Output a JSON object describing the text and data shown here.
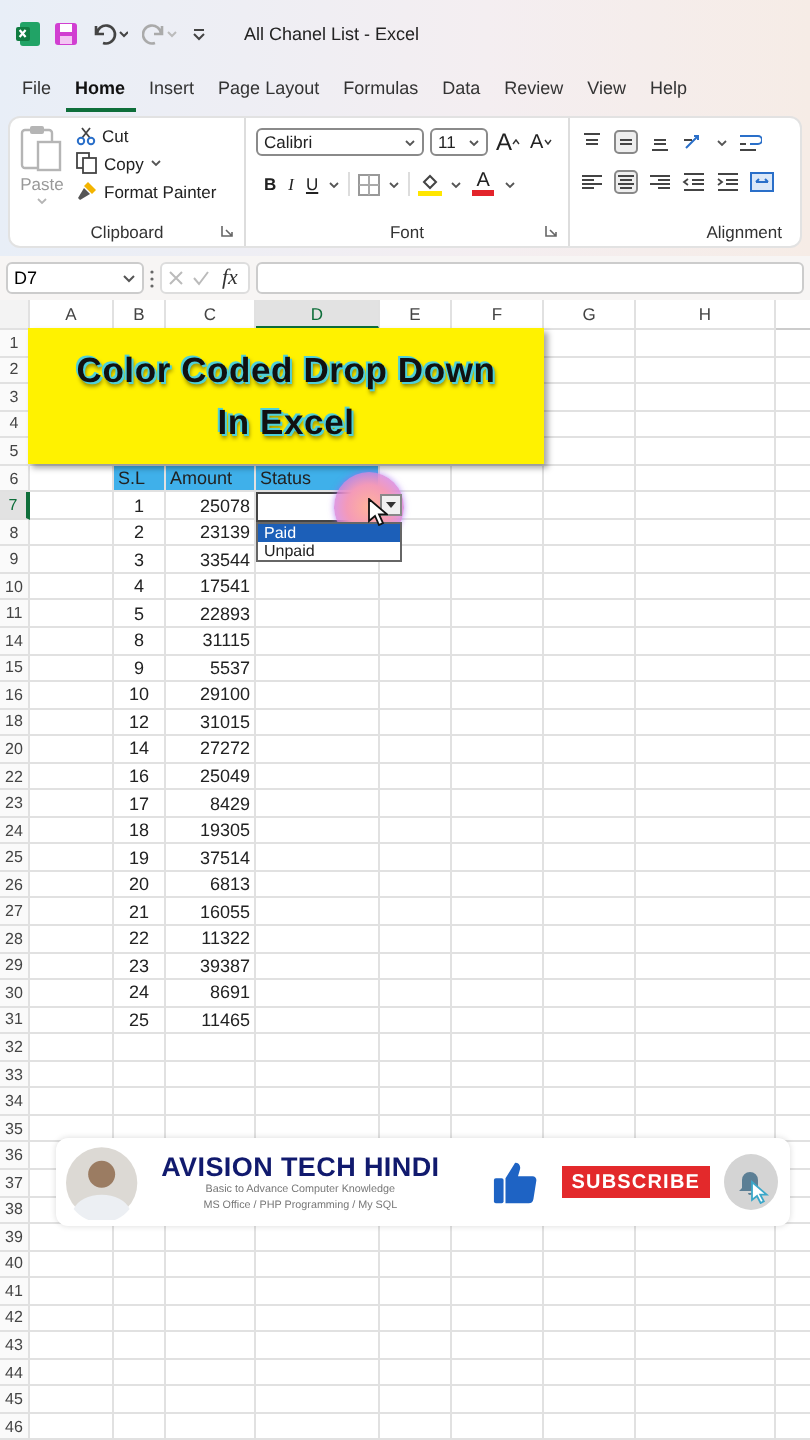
{
  "title_bar": {
    "title": "All Chanel List - Excel"
  },
  "ribbon_tabs": [
    {
      "label": "File",
      "selected": false
    },
    {
      "label": "Home",
      "selected": true
    },
    {
      "label": "Insert",
      "selected": false
    },
    {
      "label": "Page Layout",
      "selected": false
    },
    {
      "label": "Formulas",
      "selected": false
    },
    {
      "label": "Data",
      "selected": false
    },
    {
      "label": "Review",
      "selected": false
    },
    {
      "label": "View",
      "selected": false
    },
    {
      "label": "Help",
      "selected": false
    }
  ],
  "clipboard": {
    "paste": {
      "label": "Paste",
      "disabled": true
    },
    "commands": [
      "Cut",
      "Copy",
      "Format Painter"
    ],
    "group_label": "Clipboard"
  },
  "font": {
    "font_name": "Calibri",
    "font_size": "11",
    "grow_label": "A",
    "shrink_label": "A",
    "bold_label": "B",
    "italic_label": "I",
    "underline_label": "U",
    "font_color_label": "A",
    "group_label": "Font"
  },
  "alignment": {
    "group_label": "Alignment"
  },
  "formula_bar": {
    "name_box": "D7",
    "function_label": "fx"
  },
  "columns": [
    {
      "label": "A",
      "selected": false
    },
    {
      "label": "B",
      "selected": false
    },
    {
      "label": "C",
      "selected": false
    },
    {
      "label": "D",
      "selected": true
    },
    {
      "label": "E",
      "selected": false
    },
    {
      "label": "F",
      "selected": false
    },
    {
      "label": "G",
      "selected": false
    },
    {
      "label": "H",
      "selected": false
    }
  ],
  "rows": [
    {
      "number": "1",
      "selected": false,
      "kind": "empty"
    },
    {
      "number": "2",
      "selected": false,
      "kind": "empty"
    },
    {
      "number": "3",
      "selected": false,
      "kind": "empty"
    },
    {
      "number": "4",
      "selected": false,
      "kind": "empty"
    },
    {
      "number": "5",
      "selected": false,
      "kind": "empty"
    },
    {
      "number": "6",
      "selected": false,
      "kind": "header",
      "cells": [
        "S.L",
        "Amount",
        "Status"
      ]
    },
    {
      "number": "7",
      "selected": true,
      "kind": "data",
      "cells": [
        "1",
        "25078"
      ]
    },
    {
      "number": "8",
      "selected": false,
      "kind": "data",
      "cells": [
        "2",
        "23139"
      ]
    },
    {
      "number": "9",
      "selected": false,
      "kind": "data",
      "cells": [
        "3",
        "33544"
      ]
    },
    {
      "number": "10",
      "selected": false,
      "kind": "data",
      "cells": [
        "4",
        "17541"
      ]
    },
    {
      "number": "11",
      "selected": false,
      "kind": "data",
      "cells": [
        "5",
        "22893"
      ]
    },
    {
      "number": "14",
      "selected": false,
      "kind": "data",
      "cells": [
        "8",
        "31115"
      ]
    },
    {
      "number": "15",
      "selected": false,
      "kind": "data",
      "cells": [
        "9",
        "5537"
      ]
    },
    {
      "number": "16",
      "selected": false,
      "kind": "data",
      "cells": [
        "10",
        "29100"
      ]
    },
    {
      "number": "18",
      "selected": false,
      "kind": "data",
      "cells": [
        "12",
        "31015"
      ]
    },
    {
      "number": "20",
      "selected": false,
      "kind": "data",
      "cells": [
        "14",
        "27272"
      ]
    },
    {
      "number": "22",
      "selected": false,
      "kind": "data",
      "cells": [
        "16",
        "25049"
      ]
    },
    {
      "number": "23",
      "selected": false,
      "kind": "data",
      "cells": [
        "17",
        "8429"
      ]
    },
    {
      "number": "24",
      "selected": false,
      "kind": "data",
      "cells": [
        "18",
        "19305"
      ]
    },
    {
      "number": "25",
      "selected": false,
      "kind": "data",
      "cells": [
        "19",
        "37514"
      ]
    },
    {
      "number": "26",
      "selected": false,
      "kind": "data",
      "cells": [
        "20",
        "6813"
      ]
    },
    {
      "number": "27",
      "selected": false,
      "kind": "data",
      "cells": [
        "21",
        "16055"
      ]
    },
    {
      "number": "28",
      "selected": false,
      "kind": "data",
      "cells": [
        "22",
        "11322"
      ]
    },
    {
      "number": "29",
      "selected": false,
      "kind": "data",
      "cells": [
        "23",
        "39387"
      ]
    },
    {
      "number": "30",
      "selected": false,
      "kind": "data",
      "cells": [
        "24",
        "8691"
      ]
    },
    {
      "number": "31",
      "selected": false,
      "kind": "data",
      "cells": [
        "25",
        "11465"
      ]
    },
    {
      "number": "32",
      "selected": false,
      "kind": "empty"
    },
    {
      "number": "33",
      "selected": false,
      "kind": "empty"
    },
    {
      "number": "34",
      "selected": false,
      "kind": "empty"
    },
    {
      "number": "35",
      "selected": false,
      "kind": "empty"
    },
    {
      "number": "36",
      "selected": false,
      "kind": "empty"
    },
    {
      "number": "37",
      "selected": false,
      "kind": "empty"
    },
    {
      "number": "38",
      "selected": false,
      "kind": "empty"
    },
    {
      "number": "39",
      "selected": false,
      "kind": "empty"
    },
    {
      "number": "40",
      "selected": false,
      "kind": "empty"
    },
    {
      "number": "41",
      "selected": false,
      "kind": "empty"
    },
    {
      "number": "42",
      "selected": false,
      "kind": "empty"
    },
    {
      "number": "43",
      "selected": false,
      "kind": "empty"
    },
    {
      "number": "44",
      "selected": false,
      "kind": "empty"
    },
    {
      "number": "45",
      "selected": false,
      "kind": "empty"
    },
    {
      "number": "46",
      "selected": false,
      "kind": "empty"
    }
  ],
  "title_box": {
    "lines": [
      "Color Coded Drop Down",
      "In Excel"
    ]
  },
  "dropdown": {
    "options": [
      {
        "label": "Paid",
        "selected": true
      },
      {
        "label": "Unpaid",
        "selected": false
      }
    ]
  },
  "channel_banner": {
    "name": "AVISION TECH HINDI",
    "description": [
      "Basic to Advance Computer Knowledge",
      "MS Office / PHP Programming / My SQL"
    ],
    "subscribe": "SUBSCRIBE"
  }
}
